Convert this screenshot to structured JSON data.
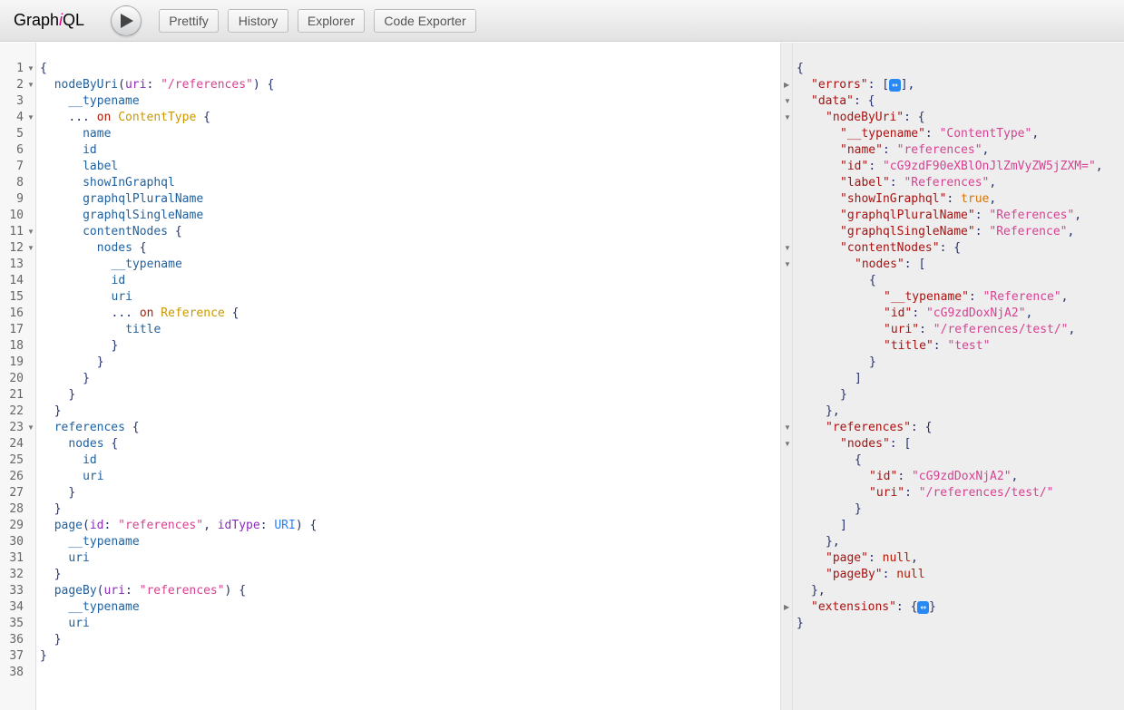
{
  "app": {
    "title_prefix": "Graph",
    "title_italic": "i",
    "title_suffix": "QL"
  },
  "toolbar": {
    "execute_label": "Execute Query",
    "buttons": [
      {
        "label": "Prettify"
      },
      {
        "label": "History"
      },
      {
        "label": "Explorer"
      },
      {
        "label": "Code Exporter"
      }
    ]
  },
  "query_lines": [
    "1",
    "2",
    "3",
    "4",
    "5",
    "6",
    "7",
    "8",
    "9",
    "10",
    "11",
    "12",
    "13",
    "14",
    "15",
    "16",
    "17",
    "18",
    "19",
    "20",
    "21",
    "22",
    "23",
    "24",
    "25",
    "26",
    "27",
    "28",
    "29",
    "30",
    "31",
    "32",
    "33",
    "34",
    "35",
    "36",
    "37",
    "38"
  ],
  "query": [
    {
      "indent": 0,
      "html": "{"
    },
    {
      "indent": 1,
      "html": "<span class='f'>nodeByUri</span>(<span class='a'>uri</span>: <span class='s'>\"/references\"</span>) {"
    },
    {
      "indent": 2,
      "html": "<span class='f'>__typename</span>"
    },
    {
      "indent": 2,
      "html": "... <span class='k'>on</span> <span class='t'>ContentType</span> {"
    },
    {
      "indent": 3,
      "html": "<span class='f'>name</span>"
    },
    {
      "indent": 3,
      "html": "<span class='f'>id</span>"
    },
    {
      "indent": 3,
      "html": "<span class='f'>label</span>"
    },
    {
      "indent": 3,
      "html": "<span class='f'>showInGraphql</span>"
    },
    {
      "indent": 3,
      "html": "<span class='f'>graphqlPluralName</span>"
    },
    {
      "indent": 3,
      "html": "<span class='f'>graphqlSingleName</span>"
    },
    {
      "indent": 3,
      "html": "<span class='f'>contentNodes</span> {"
    },
    {
      "indent": 4,
      "html": "<span class='f'>nodes</span> {"
    },
    {
      "indent": 5,
      "html": "<span class='f'>__typename</span>"
    },
    {
      "indent": 5,
      "html": "<span class='f'>id</span>"
    },
    {
      "indent": 5,
      "html": "<span class='f'>uri</span>"
    },
    {
      "indent": 5,
      "html": "... <span class='k'>on</span> <span class='t'>Reference</span> {"
    },
    {
      "indent": 6,
      "html": "<span class='f'>title</span>"
    },
    {
      "indent": 5,
      "html": "}"
    },
    {
      "indent": 4,
      "html": "}"
    },
    {
      "indent": 3,
      "html": "}"
    },
    {
      "indent": 2,
      "html": "}"
    },
    {
      "indent": 1,
      "html": "}"
    },
    {
      "indent": 1,
      "html": "<span class='f'>references</span> {"
    },
    {
      "indent": 2,
      "html": "<span class='f'>nodes</span> {"
    },
    {
      "indent": 3,
      "html": "<span class='f'>id</span>"
    },
    {
      "indent": 3,
      "html": "<span class='f'>uri</span>"
    },
    {
      "indent": 2,
      "html": "}"
    },
    {
      "indent": 1,
      "html": "}"
    },
    {
      "indent": 1,
      "html": "<span class='f'>page</span>(<span class='a'>id</span>: <span class='s'>\"references\"</span>, <span class='a'>idType</span>: <span class='jnum'>URI</span>) {"
    },
    {
      "indent": 2,
      "html": "<span class='f'>__typename</span>"
    },
    {
      "indent": 2,
      "html": "<span class='f'>uri</span>"
    },
    {
      "indent": 1,
      "html": "}"
    },
    {
      "indent": 1,
      "html": "<span class='f'>pageBy</span>(<span class='a'>uri</span>: <span class='s'>\"references\"</span>) {"
    },
    {
      "indent": 2,
      "html": "<span class='f'>__typename</span>"
    },
    {
      "indent": 2,
      "html": "<span class='f'>uri</span>"
    },
    {
      "indent": 1,
      "html": "}"
    },
    {
      "indent": 0,
      "html": "}"
    },
    {
      "indent": 0,
      "html": ""
    }
  ],
  "query_folds": [
    1,
    2,
    4,
    11,
    12,
    23
  ],
  "result": [
    {
      "indent": 0,
      "html": "{"
    },
    {
      "indent": 1,
      "html": "<span class='jk'>\"errors\"</span>: [<span class='collapsed'>↔</span>],"
    },
    {
      "indent": 1,
      "html": "<span class='jk'>\"data\"</span>: {"
    },
    {
      "indent": 2,
      "html": "<span class='jk'>\"nodeByUri\"</span>: {"
    },
    {
      "indent": 3,
      "html": "<span class='jk'>\"__typename\"</span>: <span class='jb'>\"ContentType\"</span>,"
    },
    {
      "indent": 3,
      "html": "<span class='jk'>\"name\"</span>: <span class='jb'>\"references\"</span>,"
    },
    {
      "indent": 3,
      "html": "<span class='jk'>\"id\"</span>: <span class='jb'>\"cG9zdF90eXBlOnJlZmVyZW5jZXM=\"</span>,"
    },
    {
      "indent": 3,
      "html": "<span class='jk'>\"label\"</span>: <span class='jb'>\"References\"</span>,"
    },
    {
      "indent": 3,
      "html": "<span class='jk'>\"showInGraphql\"</span>: <span class='jtrue'>true</span>,"
    },
    {
      "indent": 3,
      "html": "<span class='jk'>\"graphqlPluralName\"</span>: <span class='jb'>\"References\"</span>,"
    },
    {
      "indent": 3,
      "html": "<span class='jk'>\"graphqlSingleName\"</span>: <span class='jb'>\"Reference\"</span>,"
    },
    {
      "indent": 3,
      "html": "<span class='jk'>\"contentNodes\"</span>: {"
    },
    {
      "indent": 4,
      "html": "<span class='jk'>\"nodes\"</span>: ["
    },
    {
      "indent": 5,
      "html": "{"
    },
    {
      "indent": 6,
      "html": "<span class='jk'>\"__typename\"</span>: <span class='jb'>\"Reference\"</span>,"
    },
    {
      "indent": 6,
      "html": "<span class='jk'>\"id\"</span>: <span class='jb'>\"cG9zdDoxNjA2\"</span>,"
    },
    {
      "indent": 6,
      "html": "<span class='jk'>\"uri\"</span>: <span class='jb'>\"/references/test/\"</span>,"
    },
    {
      "indent": 6,
      "html": "<span class='jk'>\"title\"</span>: <span class='jb'>\"test\"</span>"
    },
    {
      "indent": 5,
      "html": "}"
    },
    {
      "indent": 4,
      "html": "]"
    },
    {
      "indent": 3,
      "html": "}"
    },
    {
      "indent": 2,
      "html": "},"
    },
    {
      "indent": 2,
      "html": "<span class='jk'>\"references\"</span>: {"
    },
    {
      "indent": 3,
      "html": "<span class='jk'>\"nodes\"</span>: ["
    },
    {
      "indent": 4,
      "html": "{"
    },
    {
      "indent": 5,
      "html": "<span class='jk'>\"id\"</span>: <span class='jb'>\"cG9zdDoxNjA2\"</span>,"
    },
    {
      "indent": 5,
      "html": "<span class='jk'>\"uri\"</span>: <span class='jb'>\"/references/test/\"</span>"
    },
    {
      "indent": 4,
      "html": "}"
    },
    {
      "indent": 3,
      "html": "]"
    },
    {
      "indent": 2,
      "html": "},"
    },
    {
      "indent": 2,
      "html": "<span class='jk'>\"page\"</span>: <span class='jnull'>null</span>,"
    },
    {
      "indent": 2,
      "html": "<span class='jk'>\"pageBy\"</span>: <span class='jnull'>null</span>"
    },
    {
      "indent": 1,
      "html": "},"
    },
    {
      "indent": 1,
      "html": "<span class='jk'>\"extensions\"</span>: {<span class='collapsed'>↔</span>}"
    },
    {
      "indent": 0,
      "html": "}"
    }
  ],
  "result_folds": {
    "collapsed": [
      1,
      33
    ],
    "open": [
      2,
      3,
      11,
      12,
      22,
      23
    ]
  }
}
